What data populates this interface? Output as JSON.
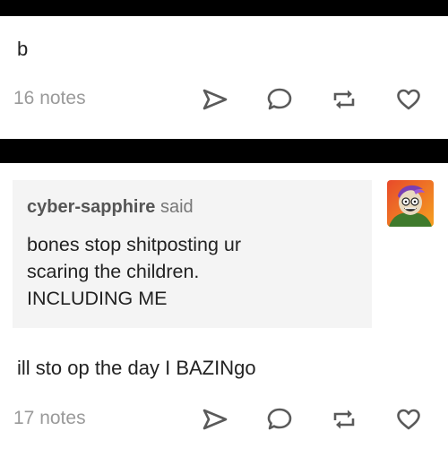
{
  "post1": {
    "text": "b",
    "notes": "16 notes"
  },
  "post2": {
    "ask": {
      "asker": "cyber-sapphire",
      "said": "said",
      "question_lines": [
        "bones stop shitposting ur",
        "scaring the children.",
        "INCLUDING ME"
      ]
    },
    "answer": "ill sto op the day I BAZINgo",
    "notes": "17 notes"
  },
  "icons": {
    "share": "paper-plane-icon",
    "reply": "speech-bubble-icon",
    "reblog": "reblog-icon",
    "like": "heart-icon",
    "avatar": "avatar-image"
  },
  "colors": {
    "divider": "#000000",
    "notes": "#9a9a9a",
    "icon": "#5a5a5a",
    "ask_bg": "#f4f4f4"
  }
}
